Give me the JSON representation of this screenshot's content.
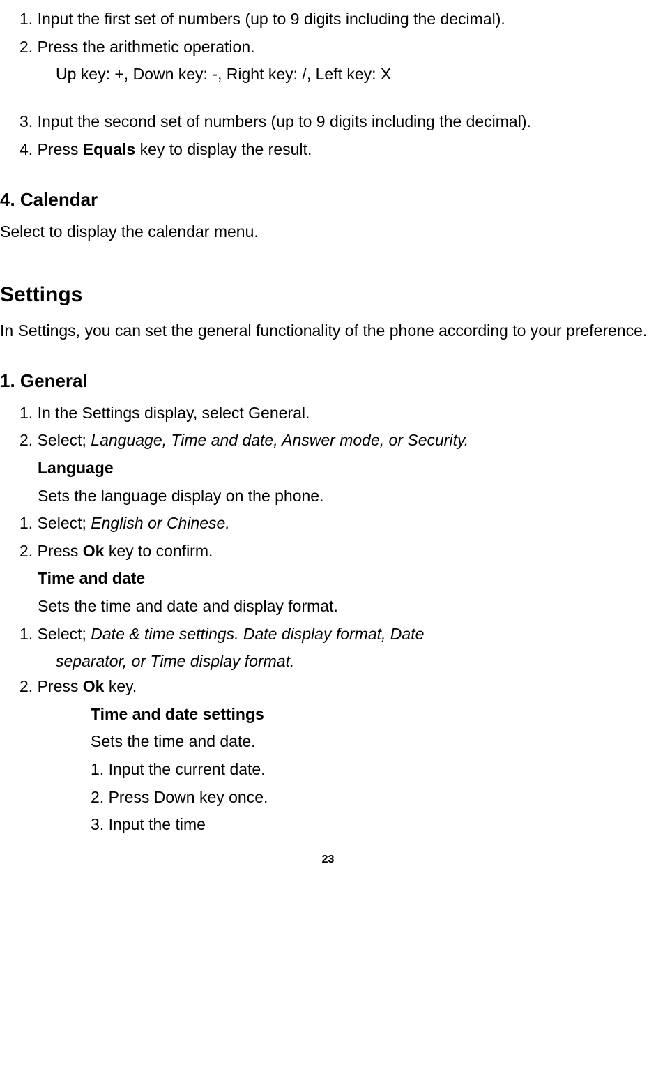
{
  "top_list": {
    "item1": "1. Input the first set of numbers (up to 9 digits including the decimal).",
    "item2": "2. Press the arithmetic operation.",
    "item2_sub": "Up key: +, Down key: -, Right key: /, Left key: X",
    "item3": "3. Input the second set of numbers (up to 9 digits including the decimal).",
    "item4_prefix": "4. Press ",
    "item4_bold": "Equals",
    "item4_suffix": " key to display the result."
  },
  "calendar": {
    "heading": "4. Calendar",
    "text": "Select to display the calendar menu."
  },
  "settings": {
    "heading": "Settings",
    "intro": "In Settings, you can set the general functionality of the phone according to your preference."
  },
  "general": {
    "heading": "1. General",
    "item1": "1. In the Settings display, select General.",
    "item2_prefix": "2. Select; ",
    "item2_italic": "Language, Time and date, Answer mode, or Security.",
    "language": {
      "heading": "Language",
      "desc": "Sets the language display on the phone.",
      "step1_prefix": "1. Select; ",
      "step1_italic": "English or Chinese.",
      "step2_prefix": "2. Press ",
      "step2_bold": "Ok",
      "step2_suffix": " key to confirm."
    },
    "timedate": {
      "heading": "Time and date",
      "desc": "Sets the time and date and display format.",
      "step1_prefix": "1. Select; ",
      "step1_italic_a": "Date & time settings. Date display format, Date",
      "step1_italic_b": "separator, or Time display format.",
      "step2_prefix": "2. Press ",
      "step2_bold": "Ok",
      "step2_suffix": " key.",
      "sub": {
        "heading": "Time and date settings",
        "desc": "Sets the time and date.",
        "s1": "1. Input the current date.",
        "s2": "2. Press Down key once.",
        "s3": "3. Input the time"
      }
    }
  },
  "page_number": "23"
}
